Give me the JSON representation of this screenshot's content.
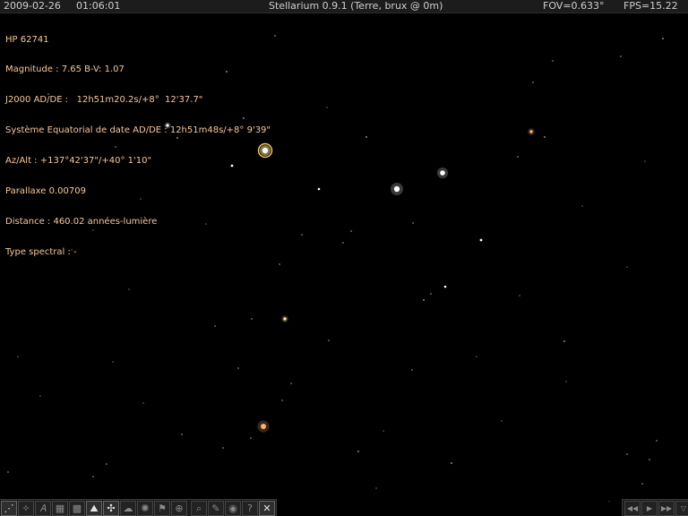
{
  "topbar": {
    "date": "2009-02-26",
    "time": "01:06:01",
    "title": "Stellarium 0.9.1 (Terre, brux @ 0m)",
    "fov": "FOV=0.633°",
    "fps": "FPS=15.22"
  },
  "star_info": {
    "name": "HP 62741",
    "magnitude": "Magnitude : 7.65 B-V: 1.07",
    "j2000": "J2000 AD/DE :   12h51m20.2s/+8°  12'37.7\"",
    "equatorial_date": "Système Equatorial de date AD/DE : 12h51m48s/+8° 9'39\"",
    "az_alt": "Az/Alt : +137°42'37\"/+40° 1'10\"",
    "parallax": "Parallaxe 0.00709",
    "distance": "Distance : 460.02 années-lumière",
    "spectral": "Type spectral : -"
  },
  "colors": {
    "info_text": "#f5c89b",
    "star_white": "#ffffff",
    "star_orange": "#ffb070",
    "selection_ring": "#ffcc55"
  },
  "toolbar": {
    "buttons": [
      {
        "icon": "constellation-lines-icon",
        "glyph": "⋰",
        "active": true
      },
      {
        "icon": "constellation-art-icon",
        "glyph": "✧",
        "active": false
      },
      {
        "icon": "constellation-names-icon",
        "glyph": "𝛢",
        "active": false
      },
      {
        "icon": "equatorial-grid-icon",
        "glyph": "▦",
        "active": false
      },
      {
        "icon": "azimuthal-grid-icon",
        "glyph": "▩",
        "active": false
      },
      {
        "icon": "ground-icon",
        "glyph": "⛰",
        "active": true
      },
      {
        "icon": "cardinal-points-icon",
        "glyph": "✣",
        "active": true
      },
      {
        "icon": "atmosphere-icon",
        "glyph": "☁",
        "active": false
      },
      {
        "icon": "nebulae-icon",
        "glyph": "✺",
        "active": false
      },
      {
        "icon": "planet-labels-icon",
        "glyph": "⚑",
        "active": false
      },
      {
        "icon": "equatorial-mount-icon",
        "glyph": "⊕",
        "active": false
      },
      {
        "icon": "search-icon",
        "glyph": "⌕",
        "active": false
      },
      {
        "icon": "configuration-icon",
        "glyph": "✎",
        "active": false
      },
      {
        "icon": "night-mode-icon",
        "glyph": "◉",
        "active": false
      },
      {
        "icon": "help-icon",
        "glyph": "?",
        "active": false
      },
      {
        "icon": "quit-icon",
        "glyph": "✕",
        "active": true
      }
    ],
    "time_buttons": [
      {
        "icon": "rewind-icon",
        "glyph": "◀◀"
      },
      {
        "icon": "play-icon",
        "glyph": "▶"
      },
      {
        "icon": "fast-forward-icon",
        "glyph": "▶▶"
      },
      {
        "icon": "realtime-icon",
        "glyph": "▽"
      }
    ]
  }
}
